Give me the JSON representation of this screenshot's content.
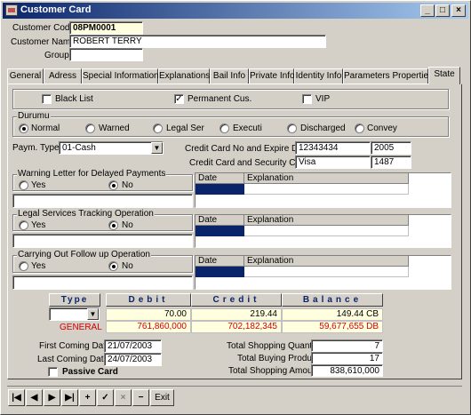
{
  "window": {
    "title": "Customer Card",
    "controls": [
      "_",
      "□",
      "×"
    ]
  },
  "header": {
    "customer_code_label": "Customer Code",
    "customer_code": "08PM0001",
    "customer_name_label": "Customer Name",
    "customer_name": "ROBERT TERRY",
    "group_label": "Group",
    "group": ""
  },
  "tabs": [
    {
      "label": "General"
    },
    {
      "label": "Adress"
    },
    {
      "label": "Special Informations"
    },
    {
      "label": "Explanations"
    },
    {
      "label": "Bail Info"
    },
    {
      "label": "Private Info"
    },
    {
      "label": "Identity Info"
    },
    {
      "label": "Parameters Properties"
    },
    {
      "label": "State"
    }
  ],
  "active_tab": "State",
  "flags": {
    "black_list": {
      "label": "Black List",
      "checked": false
    },
    "permanent": {
      "label": "Permanent Cus.",
      "checked": true,
      "mark": "✓"
    },
    "vip": {
      "label": "VIP",
      "checked": false
    }
  },
  "durumu": {
    "title": "Durumu",
    "options": [
      "Normal",
      "Warned",
      "Legal Ser",
      "Executi",
      "Discharged",
      "Convey"
    ],
    "selected": "Normal"
  },
  "payment": {
    "label": "Paym. Type",
    "value": "01-Cash",
    "cc_no_label": "Credit Card No and Expire Date",
    "cc_no": "12343434",
    "cc_expire": "2005",
    "cc_sec_label": "Credit Card and Security Code",
    "cc_type": "Visa",
    "cc_sec": "1487"
  },
  "sections": [
    {
      "title": "Warning Letter for Delayed Payments",
      "yes": "Yes",
      "no": "No",
      "selected": "No",
      "col_date": "Date",
      "col_expl": "Explanation"
    },
    {
      "title": "Legal Services Tracking Operation",
      "yes": "Yes",
      "no": "No",
      "selected": "No",
      "col_date": "Date",
      "col_expl": "Explanation"
    },
    {
      "title": "Carrying Out Follow up Operation",
      "yes": "Yes",
      "no": "No",
      "selected": "No",
      "col_date": "Date",
      "col_expl": "Explanation"
    }
  ],
  "totals": {
    "type_header": "Type",
    "debit_header": "Debit",
    "credit_header": "Credit",
    "balance_header": "Balance",
    "row1": {
      "debit": "70.00",
      "credit": "219.44",
      "balance": "149.44 CB"
    },
    "row2": {
      "label": "GENERAL",
      "debit": "761,860,000",
      "credit": "702,182,345",
      "balance": "59,677,655 DB"
    }
  },
  "dates": {
    "first_label": "First Coming Date",
    "first": "21/07/2003",
    "last_label": "Last Coming Date",
    "last": "24/07/2003",
    "passive_label": "Passive Card"
  },
  "shopping": {
    "qty_label": "Total Shopping Quantity",
    "qty": "7",
    "product_label": "Total Buying Product",
    "product": "17",
    "amount_label": "Total Shopping Amount",
    "amount": "838,610,000"
  },
  "navigator": {
    "buttons": [
      "|◀",
      "◀",
      "▶",
      "▶|",
      "+",
      "✓",
      "×",
      "−"
    ],
    "exit_label": "Exit"
  },
  "colors": {
    "title_bar": "#0a246a",
    "selection": "#0a246a",
    "negative": "#d40000"
  }
}
